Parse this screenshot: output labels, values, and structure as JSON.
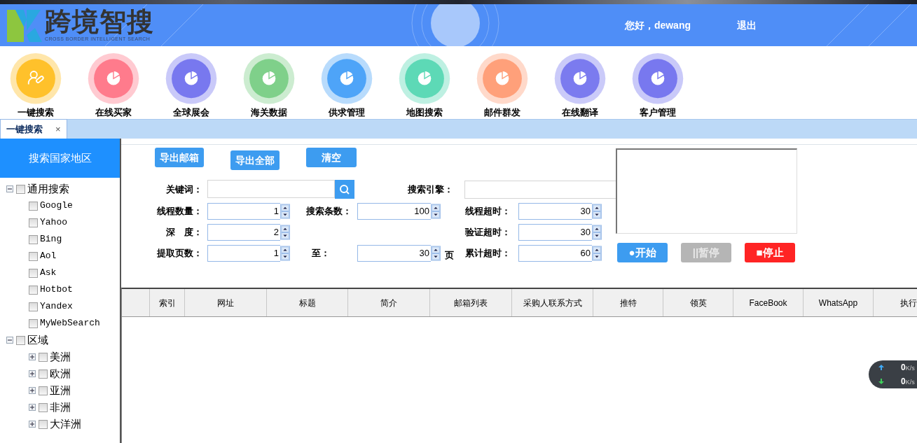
{
  "header": {
    "logo_text": "跨境智搜",
    "logo_subtitle": "CROSS BORDER INTELLIGENT SEARCH",
    "greeting": "您好，dewang",
    "logout": "退出"
  },
  "nav": [
    {
      "label": "一键搜索",
      "kind": "user",
      "color": "#ffc12b"
    },
    {
      "label": "在线买家",
      "kind": "pie",
      "color": "#ff7b8c"
    },
    {
      "label": "全球展会",
      "kind": "pie",
      "color": "#7878ef"
    },
    {
      "label": "海关数据",
      "kind": "pie",
      "color": "#7fd08a"
    },
    {
      "label": "供求管理",
      "kind": "pie",
      "color": "#4ea4f8"
    },
    {
      "label": "地图搜索",
      "kind": "pie",
      "color": "#5dd9b6"
    },
    {
      "label": "邮件群发",
      "kind": "pie",
      "color": "#ffa07a"
    },
    {
      "label": "在线翻译",
      "kind": "pie",
      "color": "#7b7bef"
    },
    {
      "label": "客户管理",
      "kind": "pie",
      "color": "#7878ef"
    }
  ],
  "tabs": [
    {
      "label": "一键搜索",
      "close": "×",
      "selected": true
    }
  ],
  "sidebar": {
    "title": "搜索国家地区",
    "tree": [
      {
        "label": "通用搜索",
        "checked": false,
        "expanded": true,
        "children": [
          {
            "label": "Google",
            "checked": false
          },
          {
            "label": "Yahoo",
            "checked": false
          },
          {
            "label": "Bing",
            "checked": false
          },
          {
            "label": "Aol",
            "checked": false
          },
          {
            "label": "Ask",
            "checked": false
          },
          {
            "label": "Hotbot",
            "checked": false
          },
          {
            "label": "Yandex",
            "checked": false
          },
          {
            "label": "MyWebSearch",
            "checked": false
          }
        ]
      },
      {
        "label": "区域",
        "checked": false,
        "expanded": true,
        "children": [
          {
            "label": "美洲",
            "checked": false,
            "expanded": false
          },
          {
            "label": "欧洲",
            "checked": false,
            "expanded": false
          },
          {
            "label": "亚洲",
            "checked": false,
            "expanded": false
          },
          {
            "label": "非洲",
            "checked": false,
            "expanded": false
          },
          {
            "label": "大洋洲",
            "checked": false,
            "expanded": false
          }
        ]
      }
    ]
  },
  "actions": [
    "导出邮箱",
    "导出全部",
    "清空"
  ],
  "form": {
    "keyword": {
      "label": "关键词："
    },
    "engine": {
      "label": "搜索引擎："
    },
    "rows": [
      {
        "left": {
          "label": "线程数量：",
          "value": "1"
        },
        "middle": {
          "label": "搜索条数：",
          "value": "100"
        },
        "right": {
          "label": "线程超时：",
          "value": "30"
        }
      },
      {
        "left": {
          "label": "深　度：",
          "value": "2"
        },
        "right": {
          "label": "验证超时：",
          "value": "30"
        }
      },
      {
        "left": {
          "label": "提取页数：",
          "value": "1"
        },
        "middle": {
          "label": "至：",
          "value": "30",
          "unit": "页"
        },
        "right": {
          "label": "累计超时：",
          "value": "60"
        }
      }
    ]
  },
  "controls": [
    {
      "kind": "start",
      "label": "●开始",
      "disabled": false
    },
    {
      "kind": "pause",
      "label": "||暂停",
      "disabled": true
    },
    {
      "kind": "stop",
      "label": "■停止",
      "disabled": false
    }
  ],
  "table": {
    "columns": [
      "索引",
      "网址",
      "标题",
      "简介",
      "邮箱列表",
      "采购人联系方式",
      "推特",
      "领英",
      "FaceBook",
      "WhatsApp",
      "执行"
    ]
  },
  "net_monitor": [
    {
      "kind": "up",
      "value": "0",
      "unit": "K/s"
    },
    {
      "kind": "down",
      "value": "0",
      "unit": "K/s"
    }
  ]
}
